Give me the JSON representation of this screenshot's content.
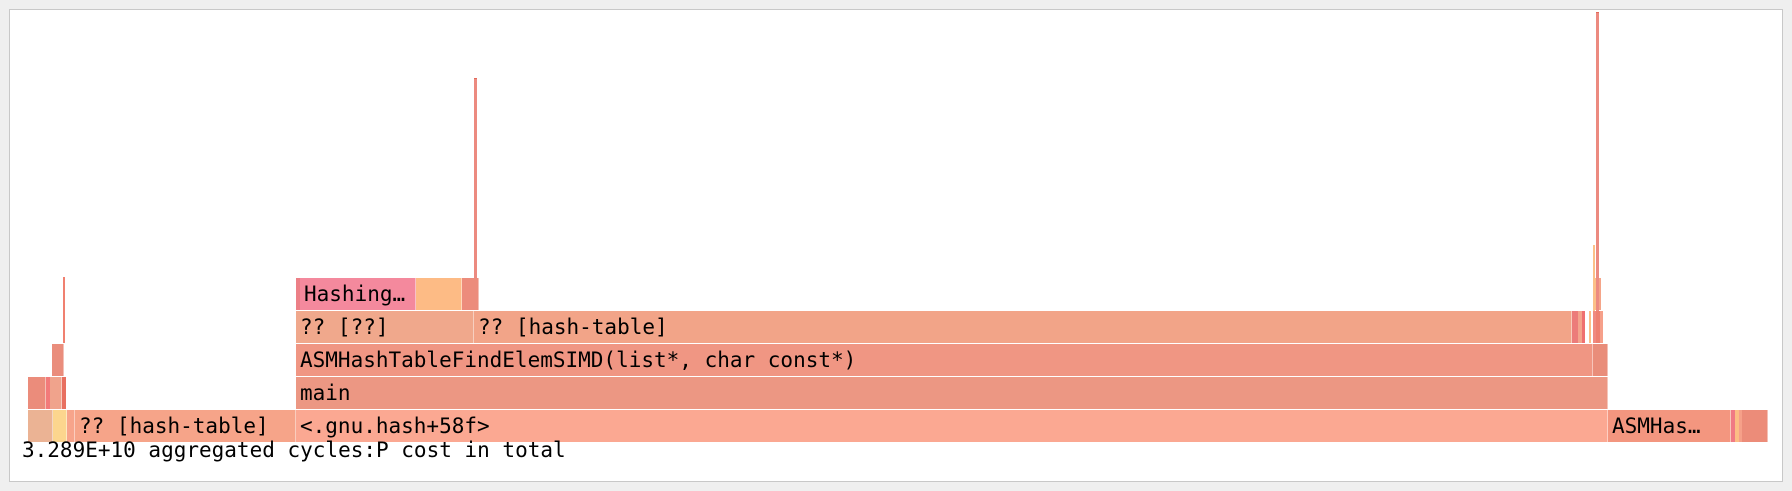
{
  "frames": {
    "gnu_hash": "<.gnu.hash+58f>",
    "hash_table_left": "?? [hash-table]",
    "asmhash_right": "ASMHas…",
    "main": "main",
    "find_elem_simd": "ASMHashTableFindElemSIMD(list*, char const*)",
    "unknown": "?? [??]",
    "hash_table": "?? [hash-table]",
    "hashing": "Hashing…"
  },
  "footer": {
    "total_cost": "3.289E+10 aggregated cycles:P cost in total"
  },
  "colors": {
    "background": "#ffffff",
    "frame_light": "#fba892",
    "frame_main": "#ec9783",
    "frame_mid": "#f2a488",
    "frame_hashing": "#f4899d",
    "frame_orange": "#fdbb85"
  }
}
